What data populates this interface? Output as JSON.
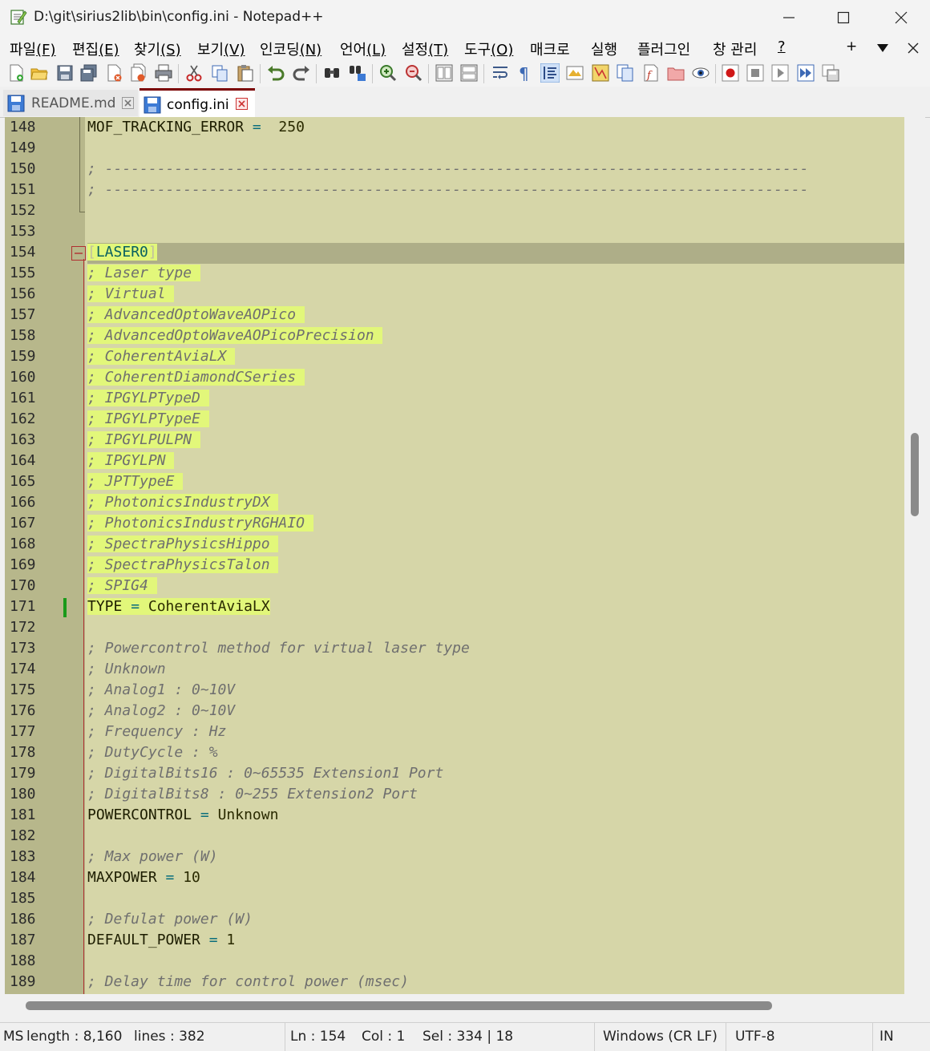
{
  "window": {
    "title": "D:\\git\\sirius2lib\\bin\\config.ini - Notepad++",
    "minimize": "—",
    "maximize": "☐",
    "close": "✕"
  },
  "menu": {
    "items": [
      {
        "label": "파일",
        "key": "(F)"
      },
      {
        "label": "편집",
        "key": "(E)"
      },
      {
        "label": "찾기",
        "key": "(S)"
      },
      {
        "label": "보기",
        "key": "(V)"
      },
      {
        "label": "인코딩",
        "key": "(N)"
      },
      {
        "label": "언어",
        "key": "(L)"
      },
      {
        "label": "설정",
        "key": "(T)"
      },
      {
        "label": "도구",
        "key": "(O)"
      },
      {
        "label": "매크로",
        "key": ""
      },
      {
        "label": "실행",
        "key": ""
      },
      {
        "label": "플러그인",
        "key": ""
      },
      {
        "label": "창 관리",
        "key": ""
      },
      {
        "label": "",
        "key": "?"
      }
    ],
    "right": {
      "plus": "+",
      "dropdown": "▼",
      "close": "✕"
    }
  },
  "tabs": [
    {
      "label": "README.md"
    },
    {
      "label": "config.ini"
    }
  ],
  "editor": {
    "lines": [
      {
        "n": "148",
        "kind": "kv",
        "key": "MOF_TRACKING_ERROR",
        "op": " = ",
        "val": " 250"
      },
      {
        "n": "149",
        "kind": "blank"
      },
      {
        "n": "150",
        "kind": "comment",
        "text": "; ---------------------------------------------------------------------------------"
      },
      {
        "n": "151",
        "kind": "comment",
        "text": "; ---------------------------------------------------------------------------------"
      },
      {
        "n": "152",
        "kind": "blank"
      },
      {
        "n": "153",
        "kind": "blank"
      },
      {
        "n": "154",
        "kind": "section",
        "text": "LASER0"
      },
      {
        "n": "155",
        "kind": "comment-hl",
        "text": "; Laser type "
      },
      {
        "n": "156",
        "kind": "comment-hl",
        "text": "; Virtual "
      },
      {
        "n": "157",
        "kind": "comment-hl",
        "text": "; AdvancedOptoWaveAOPico "
      },
      {
        "n": "158",
        "kind": "comment-hl",
        "text": "; AdvancedOptoWaveAOPicoPrecision "
      },
      {
        "n": "159",
        "kind": "comment-hl",
        "text": "; CoherentAviaLX "
      },
      {
        "n": "160",
        "kind": "comment-hl",
        "text": "; CoherentDiamondCSeries "
      },
      {
        "n": "161",
        "kind": "comment-hl",
        "text": "; IPGYLPTypeD "
      },
      {
        "n": "162",
        "kind": "comment-hl",
        "text": "; IPGYLPTypeE "
      },
      {
        "n": "163",
        "kind": "comment-hl",
        "text": "; IPGYLPULPN "
      },
      {
        "n": "164",
        "kind": "comment-hl",
        "text": "; IPGYLPN "
      },
      {
        "n": "165",
        "kind": "comment-hl",
        "text": "; JPTTypeE "
      },
      {
        "n": "166",
        "kind": "comment-hl",
        "text": "; PhotonicsIndustryDX "
      },
      {
        "n": "167",
        "kind": "comment-hl",
        "text": "; PhotonicsIndustryRGHAIO "
      },
      {
        "n": "168",
        "kind": "comment-hl",
        "text": "; SpectraPhysicsHippo "
      },
      {
        "n": "169",
        "kind": "comment-hl",
        "text": "; SpectraPhysicsTalon "
      },
      {
        "n": "170",
        "kind": "comment-hl",
        "text": "; SPIG4 "
      },
      {
        "n": "171",
        "kind": "kv-hl",
        "key": "TYPE",
        "op": " = ",
        "val": "CoherentAviaLX"
      },
      {
        "n": "172",
        "kind": "blank"
      },
      {
        "n": "173",
        "kind": "comment",
        "text": "; Powercontrol method for virtual laser type"
      },
      {
        "n": "174",
        "kind": "comment",
        "text": "; Unknown"
      },
      {
        "n": "175",
        "kind": "comment",
        "text": "; Analog1 : 0~10V"
      },
      {
        "n": "176",
        "kind": "comment",
        "text": "; Analog2 : 0~10V"
      },
      {
        "n": "177",
        "kind": "comment",
        "text": "; Frequency : Hz"
      },
      {
        "n": "178",
        "kind": "comment",
        "text": "; DutyCycle : %"
      },
      {
        "n": "179",
        "kind": "comment",
        "text": "; DigitalBits16 : 0~65535 Extension1 Port"
      },
      {
        "n": "180",
        "kind": "comment",
        "text": "; DigitalBits8 : 0~255 Extension2 Port"
      },
      {
        "n": "181",
        "kind": "kv",
        "key": "POWERCONTROL",
        "op": " = ",
        "val": "Unknown"
      },
      {
        "n": "182",
        "kind": "blank"
      },
      {
        "n": "183",
        "kind": "comment",
        "text": "; Max power (W)"
      },
      {
        "n": "184",
        "kind": "kv",
        "key": "MAXPOWER",
        "op": " = ",
        "val": "10"
      },
      {
        "n": "185",
        "kind": "blank"
      },
      {
        "n": "186",
        "kind": "comment",
        "text": "; Defulat power (W)"
      },
      {
        "n": "187",
        "kind": "kv",
        "key": "DEFAULT_POWER",
        "op": " = ",
        "val": "1"
      },
      {
        "n": "188",
        "kind": "blank"
      },
      {
        "n": "189",
        "kind": "comment",
        "text": "; Delay time for control power (msec)"
      }
    ]
  },
  "scroll": {
    "vertical_position": 0.36,
    "vertical_size": 0.095,
    "horizontal_size": 0.83
  },
  "status": {
    "type": "MS",
    "length": "length : 8,160",
    "lines": "lines : 382",
    "ln": "Ln : 154",
    "col": "Col : 1",
    "sel": "Sel : 334 | 18",
    "eol": "Windows (CR LF)",
    "encoding": "UTF-8",
    "mode": "IN"
  },
  "colors": {
    "editor_bg": "#d6d6a8",
    "gutter_bg": "#b7b78b",
    "highlight": "#e2f77a",
    "current_line": "#aeae88",
    "comment": "#6f6f6f",
    "section": "#086060"
  },
  "icons": [
    "new-file-icon",
    "open-file-icon",
    "save-icon",
    "save-all-icon",
    "close-icon",
    "close-all-icon",
    "print-icon",
    "cut-icon",
    "copy-icon",
    "paste-icon",
    "undo-icon",
    "redo-icon",
    "find-icon",
    "replace-icon",
    "zoom-in-icon",
    "zoom-out-icon",
    "sync-v-icon",
    "sync-h-icon",
    "word-wrap-icon",
    "show-all-chars-icon",
    "indent-guide-icon",
    "udl-icon",
    "doc-map-icon",
    "doc-list-icon",
    "function-list-icon",
    "folder-workspace-icon",
    "monitoring-icon",
    "record-macro-icon",
    "stop-record-icon",
    "play-macro-icon",
    "run-macro-multiple-icon",
    "save-macro-icon"
  ]
}
